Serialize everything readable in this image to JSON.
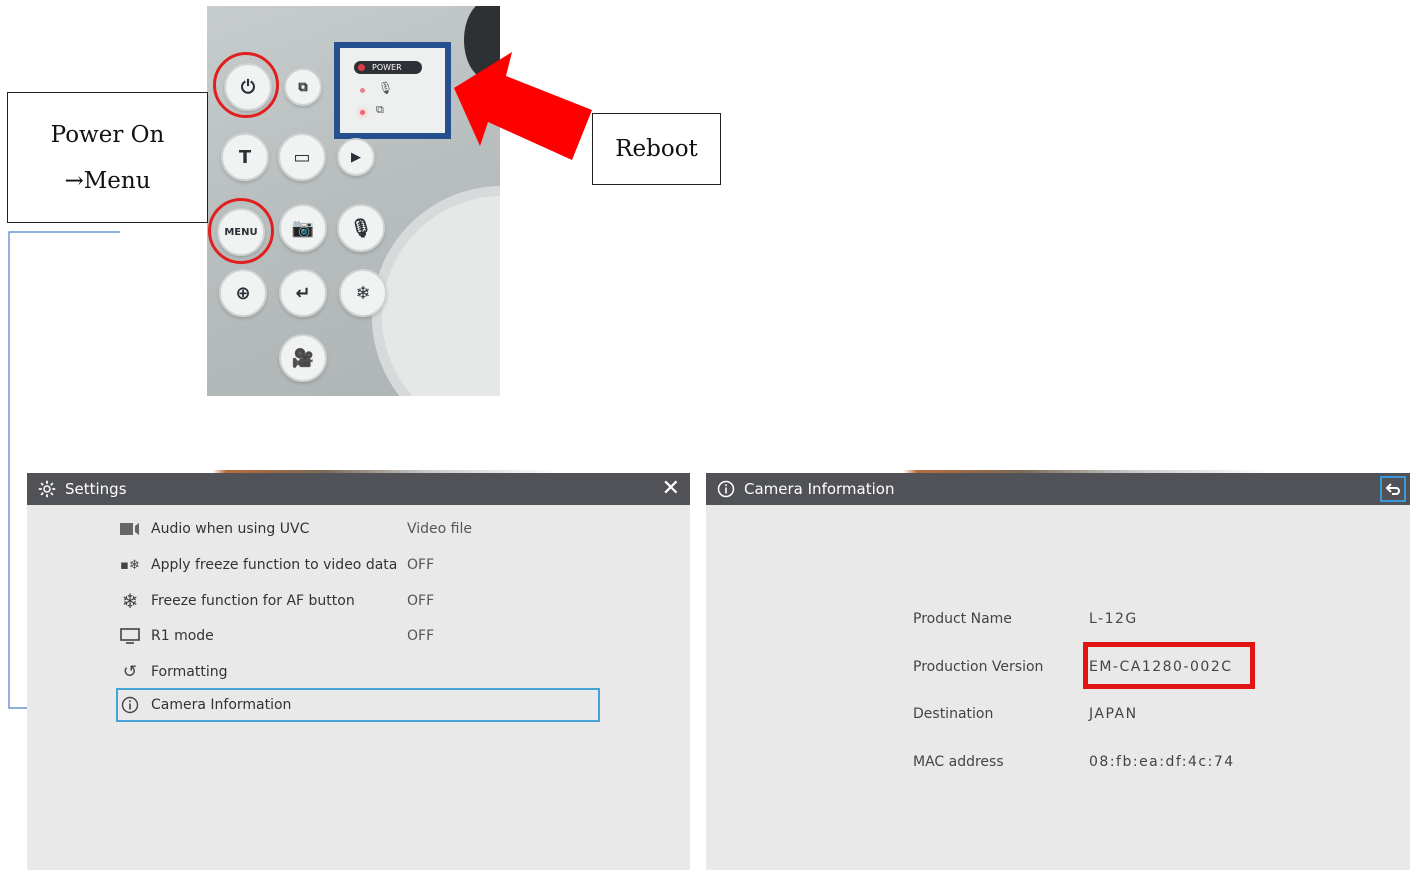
{
  "callouts": {
    "power_on_line1": "Power On",
    "power_on_line2": "→Menu",
    "reboot": "Reboot"
  },
  "device_panel": {
    "power_indicator": "POWER",
    "menu_button": "MENU",
    "accent_ring_color": "#e02020",
    "panel_frame_color": "#264f8f"
  },
  "settings": {
    "title": "Settings",
    "close_glyph": "✕",
    "items": [
      {
        "label": "Audio when using UVC",
        "value": "Video file",
        "icon": "audio-icon"
      },
      {
        "label": "Apply freeze function to video data",
        "value": "OFF",
        "icon": "freeze-video-icon"
      },
      {
        "label": "Freeze function for AF button",
        "value": "OFF",
        "icon": "snowflake-icon"
      },
      {
        "label": "R1 mode",
        "value": "OFF",
        "icon": "monitor-icon"
      },
      {
        "label": "Formatting",
        "value": "",
        "icon": "refresh-icon"
      },
      {
        "label": "Camera Information",
        "value": "",
        "icon": "info-icon",
        "selected": true
      }
    ]
  },
  "camera_info": {
    "title": "Camera Information",
    "fields": [
      {
        "label": "Product Name",
        "value": "L-12G"
      },
      {
        "label": "Production Version",
        "value": "EM-CA1280-002C"
      },
      {
        "label": "Destination",
        "value": "JAPAN"
      },
      {
        "label": "MAC address",
        "value": "08:fb:ea:df:4c:74"
      }
    ],
    "highlight_color": "#e31414"
  }
}
